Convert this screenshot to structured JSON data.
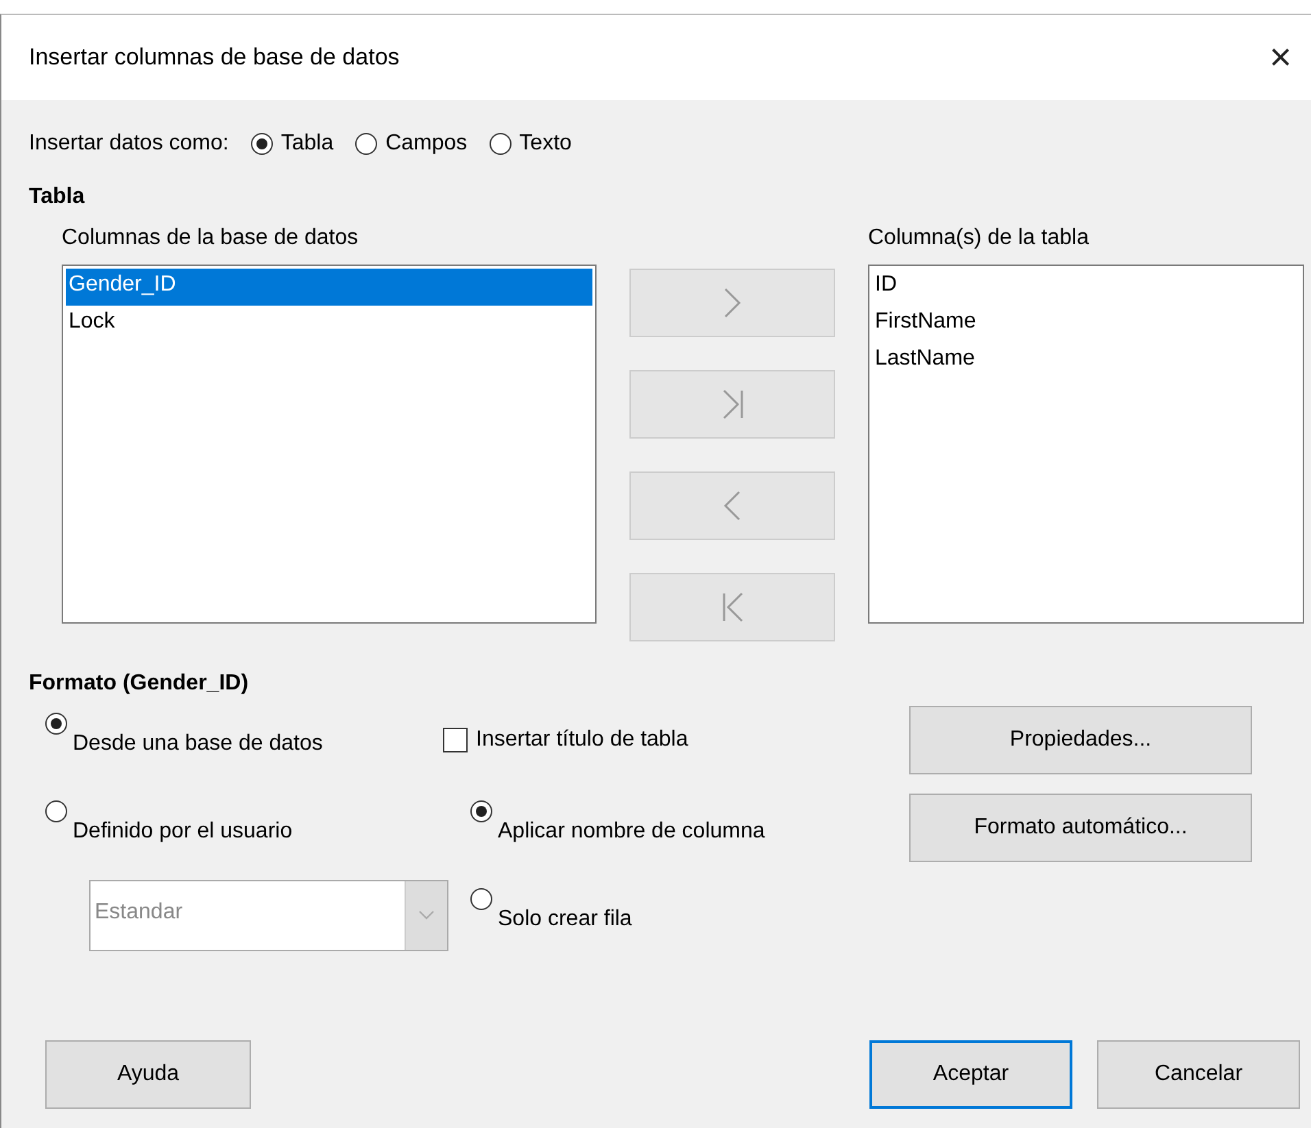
{
  "window": {
    "title": "Insertar columnas de base de datos",
    "close": "×"
  },
  "insert_as": {
    "label": "Insertar datos como:",
    "options": [
      {
        "label": "Tabla",
        "selected": true
      },
      {
        "label": "Campos",
        "selected": false
      },
      {
        "label": "Texto",
        "selected": false
      }
    ]
  },
  "table_section": {
    "heading": "Tabla",
    "database_columns": {
      "label": "Columnas de la base de datos",
      "items": [
        {
          "label": "Gender_ID",
          "selected": true
        },
        {
          "label": "Lock",
          "selected": false
        }
      ]
    },
    "move_buttons": [
      {
        "kind": "add",
        "disabled": true
      },
      {
        "kind": "add_all",
        "disabled": true
      },
      {
        "kind": "remove",
        "disabled": true
      },
      {
        "kind": "remove_all",
        "disabled": true
      }
    ],
    "table_columns": {
      "label": "Columna(s) de la tabla",
      "items": [
        {
          "label": "ID",
          "selected": false
        },
        {
          "label": "FirstName",
          "selected": false
        },
        {
          "label": "LastName",
          "selected": false
        }
      ]
    }
  },
  "format_section": {
    "heading": "Formato (Gender_ID)",
    "source": [
      {
        "label": "Desde una base de datos",
        "selected": true
      },
      {
        "label": "Definido por el usuario",
        "selected": false
      }
    ],
    "format_dropdown": {
      "value": "Estandar",
      "disabled": true
    },
    "insert_title": {
      "label": "Insertar título de tabla",
      "checked": false
    },
    "header_mode": [
      {
        "label": "Aplicar nombre de columna",
        "selected": true
      },
      {
        "label": "Solo crear fila",
        "selected": false
      }
    ],
    "buttons": [
      "Propiedades...",
      "Formato automático..."
    ]
  },
  "footer": {
    "help": "Ayuda",
    "buttons": [
      {
        "label": "Aceptar",
        "default": true
      },
      {
        "label": "Cancelar",
        "default": false
      }
    ]
  }
}
